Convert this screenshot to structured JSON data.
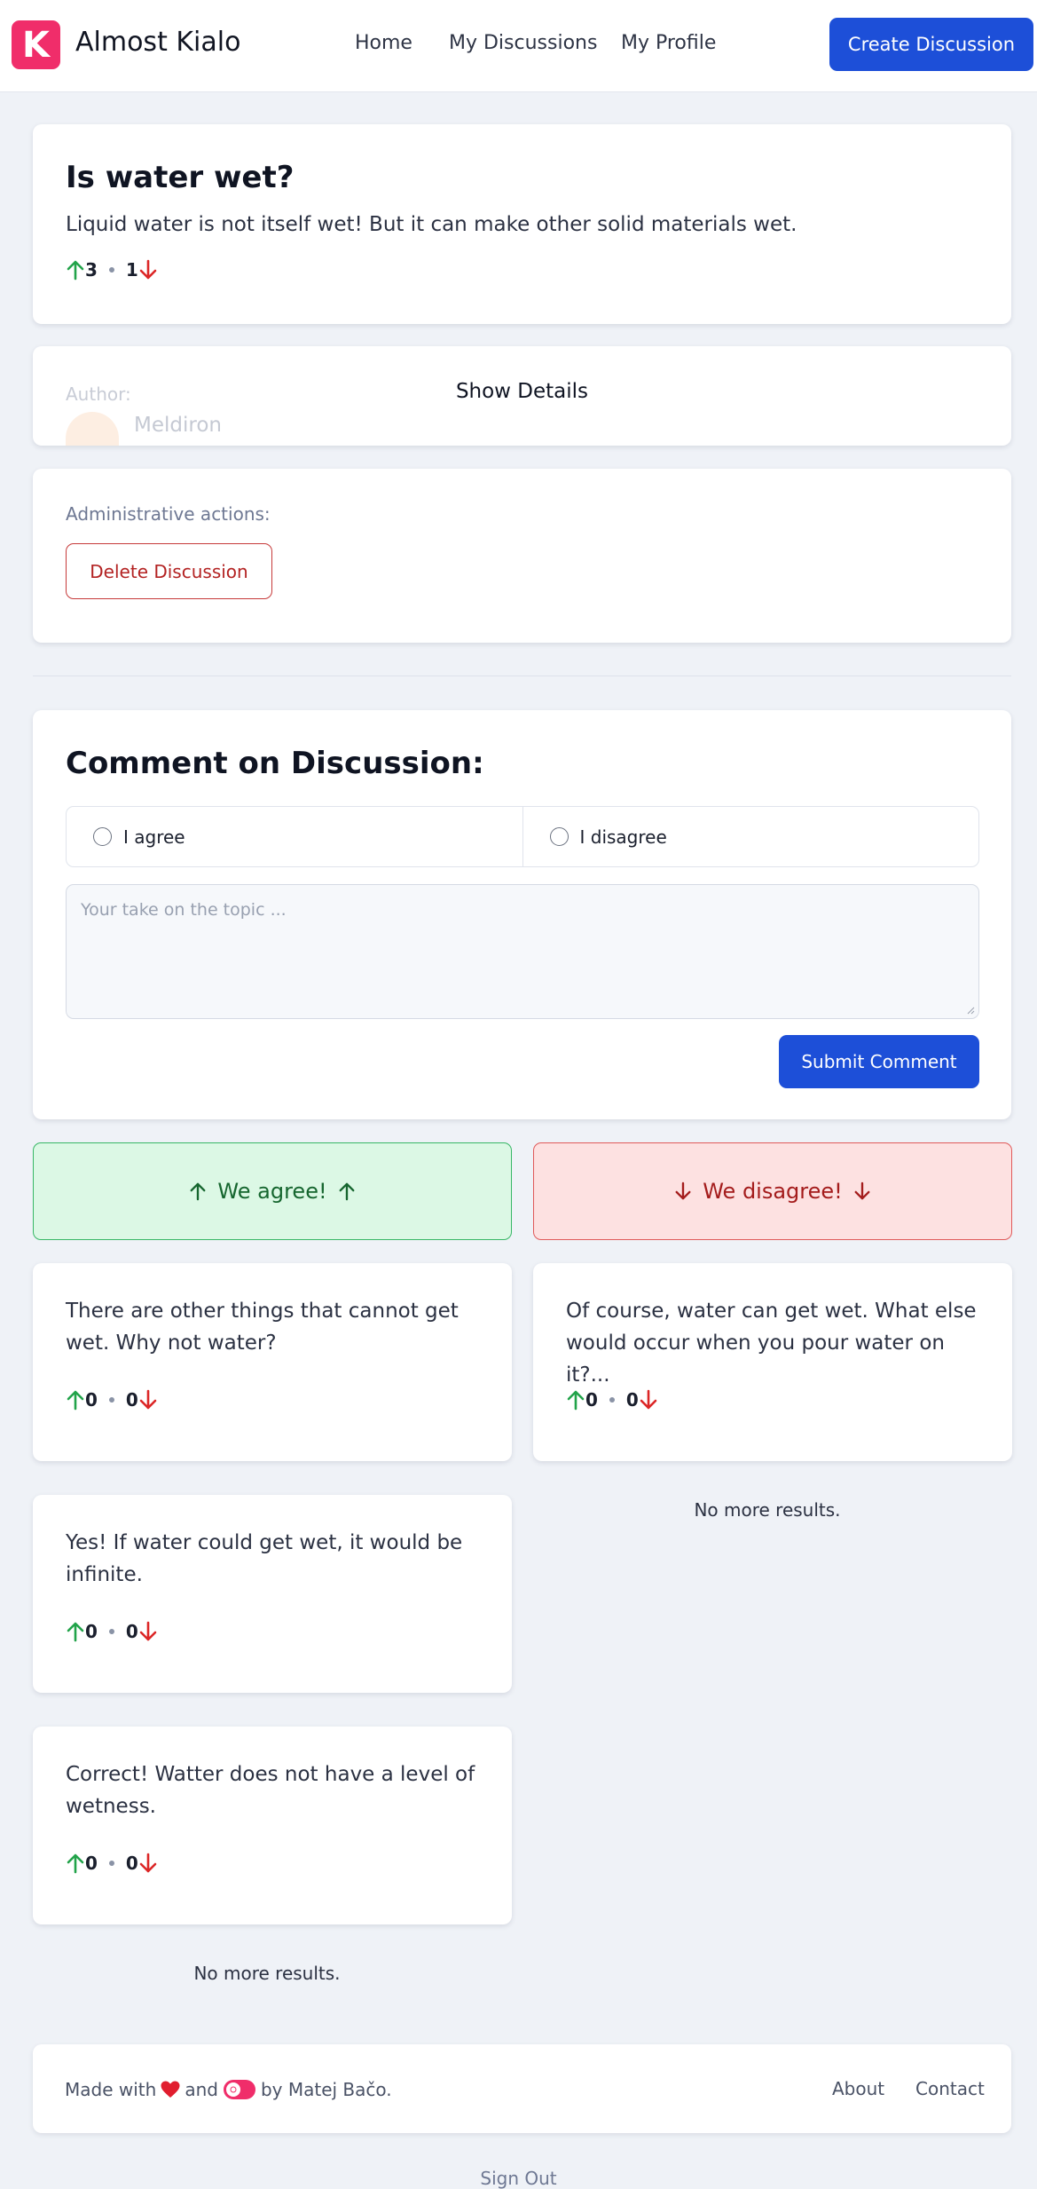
{
  "header": {
    "logo_letter": "K",
    "app_title": "Almost Kialo",
    "nav": [
      "Home",
      "My Discussions",
      "My Profile"
    ],
    "create_button": "Create Discussion"
  },
  "discussion": {
    "title": "Is water wet?",
    "description": "Liquid water is not itself wet! But it can make other solid materials wet.",
    "upvotes": "3",
    "downvotes": "1"
  },
  "details": {
    "author_label": "Author:",
    "author_name": "Meldiron",
    "show_details": "Show Details"
  },
  "admin": {
    "label": "Administrative actions:",
    "delete_button": "Delete Discussion"
  },
  "comment_form": {
    "title": "Comment on Discussion:",
    "agree_option": "I agree",
    "disagree_option": "I disagree",
    "placeholder": "Your take on the topic ...",
    "submit_button": "Submit Comment"
  },
  "agree_column": {
    "header": "We agree!",
    "comments": [
      {
        "text": "There are other things that cannot get wet. Why not water?",
        "up": "0",
        "down": "0"
      },
      {
        "text": "Yes! If water could get wet, it would be infinite.",
        "up": "0",
        "down": "0"
      },
      {
        "text": "Correct! Watter does not have a level of wetness.",
        "up": "0",
        "down": "0"
      }
    ],
    "end_text": "No more results."
  },
  "disagree_column": {
    "header": "We disagree!",
    "comments": [
      {
        "text": "Of course, water can get wet. What else would occur when you pour water on it?...",
        "up": "0",
        "down": "0"
      }
    ],
    "end_text": "No more results."
  },
  "footer": {
    "made_with": "Made with",
    "and": "and",
    "by": "by Matej Bačo.",
    "links": [
      "About",
      "Contact"
    ],
    "sign_out": "Sign Out"
  },
  "colors": {
    "accent": "#1d4fd8",
    "brand": "#f02d6a",
    "agree": "#22a34a",
    "disagree": "#dc2626"
  },
  "icons": [
    "arrow-up-icon",
    "arrow-down-icon",
    "heart-icon",
    "toggle-icon"
  ]
}
